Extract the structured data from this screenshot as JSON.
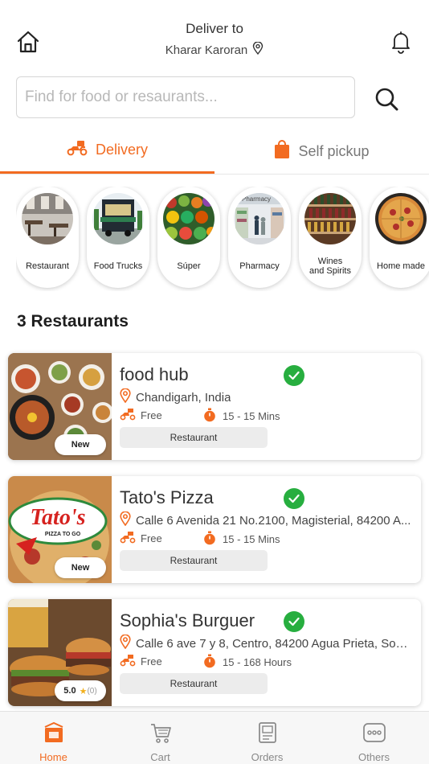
{
  "header": {
    "deliver_label": "Deliver to",
    "location": "Kharar Karoran"
  },
  "search": {
    "placeholder": "Find for food or resaurants...",
    "value": ""
  },
  "tabs": [
    {
      "label": "Delivery",
      "active": true
    },
    {
      "label": "Self pickup",
      "active": false
    }
  ],
  "categories": [
    {
      "label": "Restaurant"
    },
    {
      "label": "Food Trucks"
    },
    {
      "label": "Súper"
    },
    {
      "label": "Pharmacy",
      "sign": "Pharmacy"
    },
    {
      "label": "Wines\nand Spirits"
    },
    {
      "label": "Home made"
    }
  ],
  "section_title": "3 Restaurants",
  "restaurants": [
    {
      "name": "food hub",
      "verified": true,
      "location": "Chandigarh, India",
      "delivery_fee": "Free",
      "time": "15 - 15  Mins",
      "type": "Restaurant",
      "badge": "New"
    },
    {
      "name": "Tato's Pizza",
      "verified": true,
      "location": "Calle 6 Avenida 21 No.2100, Magisterial, 84200 A...",
      "delivery_fee": "Free",
      "time": "15 - 15  Mins",
      "type": "Restaurant",
      "badge": "New",
      "logo_text": "Tato's",
      "logo_sub": "PIZZA TO GO"
    },
    {
      "name": "Sophia's Burguer",
      "verified": true,
      "location": "Calle 6 ave 7 y 8, Centro, 84200 Agua Prieta, Son....",
      "delivery_fee": "Free",
      "time": "15 - 168 Hours",
      "type": "Restaurant",
      "rating": "5.0",
      "rating_count": "(0)"
    }
  ],
  "bottom_nav": [
    {
      "label": "Home",
      "icon": "home-bag-icon",
      "active": true
    },
    {
      "label": "Cart",
      "icon": "cart-icon",
      "active": false
    },
    {
      "label": "Orders",
      "icon": "orders-icon",
      "active": false
    },
    {
      "label": "Others",
      "icon": "more-icon",
      "active": false
    }
  ],
  "colors": {
    "accent": "#f26b21",
    "verified": "#27ae3f",
    "tag_bg": "#ececec"
  }
}
